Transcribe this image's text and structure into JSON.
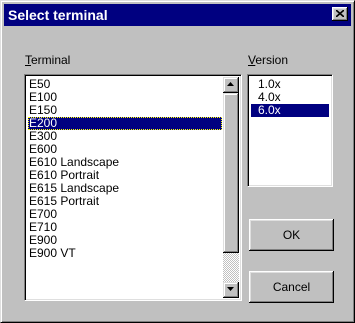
{
  "window": {
    "title": "Select terminal",
    "close_icon": "close-icon"
  },
  "terminal": {
    "label_mnemonic": "T",
    "label_rest": "erminal",
    "selected": "E200",
    "items": [
      {
        "label": "E50"
      },
      {
        "label": "E100"
      },
      {
        "label": "E150"
      },
      {
        "label": "E200"
      },
      {
        "label": "E300"
      },
      {
        "label": "E600"
      },
      {
        "label": "E610 Landscape"
      },
      {
        "label": "E610 Portrait"
      },
      {
        "label": "E615 Landscape"
      },
      {
        "label": "E615 Portrait"
      },
      {
        "label": "E700"
      },
      {
        "label": "E710"
      },
      {
        "label": "E900"
      },
      {
        "label": "E900 VT"
      }
    ]
  },
  "version": {
    "label_mnemonic": "V",
    "label_rest": "ersion",
    "selected": "6.0x",
    "items": [
      {
        "label": "1.0x"
      },
      {
        "label": "4.0x"
      },
      {
        "label": "6.0x"
      }
    ]
  },
  "buttons": {
    "ok": "OK",
    "cancel": "Cancel"
  },
  "colors": {
    "title_bar": "#000080",
    "selection": "#000080",
    "face": "#c0c0c0"
  }
}
